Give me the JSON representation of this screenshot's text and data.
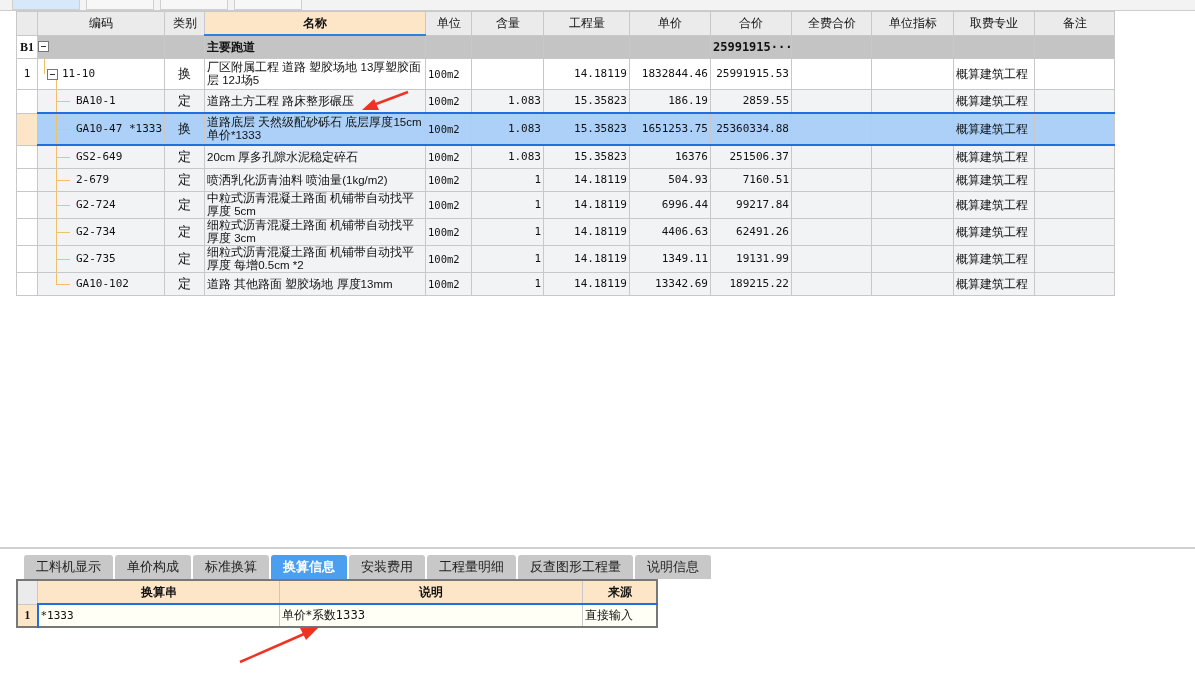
{
  "top_tabs": [
    {
      "selected": true
    },
    {
      "selected": false
    },
    {
      "selected": false
    },
    {
      "selected": false
    }
  ],
  "table": {
    "columns": [
      {
        "label": "编码",
        "selected": false
      },
      {
        "label": "类别",
        "selected": false
      },
      {
        "label": "名称",
        "selected": true
      },
      {
        "label": "单位",
        "selected": false
      },
      {
        "label": "含量",
        "selected": false
      },
      {
        "label": "工程量",
        "selected": false
      },
      {
        "label": "单价",
        "selected": false
      },
      {
        "label": "合价",
        "selected": false
      },
      {
        "label": "全费合价",
        "selected": false
      },
      {
        "label": "单位指标",
        "selected": false
      },
      {
        "label": "取费专业",
        "selected": false
      },
      {
        "label": "备注",
        "selected": false
      }
    ],
    "rows": [
      {
        "kind": "section",
        "number": "B1",
        "expanded": true,
        "selected": false,
        "name": "主要跑道",
        "total": "25991915···",
        "children": [
          {
            "number": "1",
            "code": "11-10",
            "expanded": true,
            "selected": false,
            "type": "换",
            "name": "厂区附属工程 道路 塑胶场地 13厚塑胶面层 12J场5",
            "unit": "100m2",
            "quantity": "14.18119",
            "unit_price": "1832844.46",
            "total": "25991915.53",
            "fee_category": "概算建筑工程",
            "children": [
              {
                "code": "BA10-1",
                "selected": false,
                "type": "定",
                "name": "道路土方工程 路床整形碾压",
                "unit": "100m2",
                "content": "1.083",
                "quantity": "15.35823",
                "unit_price": "186.19",
                "total": "2859.55",
                "fee_category": "概算建筑工程"
              },
              {
                "code": "GA10-47 *1333",
                "selected": true,
                "type": "换",
                "name": "道路底层 天然级配砂砾石 底层厚度15cm 单价*1333",
                "unit": "100m2",
                "content": "1.083",
                "quantity": "15.35823",
                "unit_price": "1651253.75",
                "total": "25360334.88",
                "fee_category": "概算建筑工程"
              },
              {
                "code": "GS2-649",
                "selected": false,
                "type": "定",
                "name": "20cm 厚多孔隙水泥稳定碎石",
                "unit": "100m2",
                "content": "1.083",
                "quantity": "15.35823",
                "unit_price": "16376",
                "total": "251506.37",
                "fee_category": "概算建筑工程"
              },
              {
                "code": "2-679",
                "selected": false,
                "type": "定",
                "name": "喷洒乳化沥青油料 喷油量(1kg/m2)",
                "unit": "100m2",
                "content": "1",
                "quantity": "14.18119",
                "unit_price": "504.93",
                "total": "7160.51",
                "fee_category": "概算建筑工程"
              },
              {
                "code": "G2-724",
                "selected": false,
                "type": "定",
                "name": "中粒式沥青混凝土路面 机铺带自动找平厚度 5cm",
                "unit": "100m2",
                "content": "1",
                "quantity": "14.18119",
                "unit_price": "6996.44",
                "total": "99217.84",
                "fee_category": "概算建筑工程"
              },
              {
                "code": "G2-734",
                "selected": false,
                "type": "定",
                "name": "细粒式沥青混凝土路面 机铺带自动找平厚度 3cm",
                "unit": "100m2",
                "content": "1",
                "quantity": "14.18119",
                "unit_price": "4406.63",
                "total": "62491.26",
                "fee_category": "概算建筑工程"
              },
              {
                "code": "G2-735",
                "selected": false,
                "type": "定",
                "name": "细粒式沥青混凝土路面 机铺带自动找平厚度 每增0.5cm *2",
                "unit": "100m2",
                "content": "1",
                "quantity": "14.18119",
                "unit_price": "1349.11",
                "total": "19131.99",
                "fee_category": "概算建筑工程"
              },
              {
                "code": "GA10-102",
                "selected": false,
                "type": "定",
                "name": "道路 其他路面 塑胶场地 厚度13mm",
                "unit": "100m2",
                "content": "1",
                "quantity": "14.18119",
                "unit_price": "13342.69",
                "total": "189215.22",
                "fee_category": "概算建筑工程"
              }
            ]
          }
        ]
      }
    ]
  },
  "detail_tabs": [
    {
      "label": "工料机显示",
      "selected": false
    },
    {
      "label": "单价构成",
      "selected": false
    },
    {
      "label": "标准换算",
      "selected": false
    },
    {
      "label": "换算信息",
      "selected": true
    },
    {
      "label": "安装费用",
      "selected": false
    },
    {
      "label": "工程量明细",
      "selected": false
    },
    {
      "label": "反查图形工程量",
      "selected": false
    },
    {
      "label": "说明信息",
      "selected": false
    }
  ],
  "conversion_table": {
    "columns": [
      "换算串",
      "说明",
      "来源"
    ],
    "rows": [
      {
        "number": "1",
        "selected": true,
        "string": "*1333",
        "description": "单价*系数1333",
        "source": "直接输入"
      }
    ]
  }
}
